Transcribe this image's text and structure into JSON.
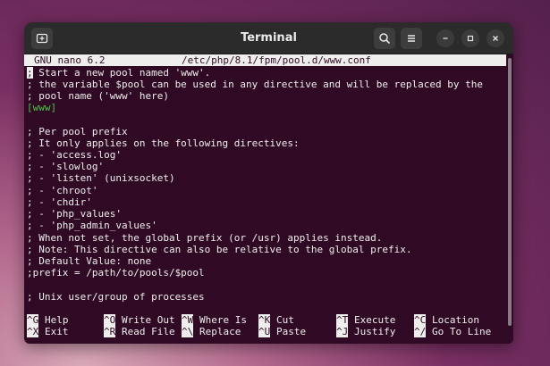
{
  "window": {
    "title": "Terminal",
    "new_tab_icon": "new-tab-icon",
    "search_icon": "search-icon",
    "menu_icon": "hamburger-menu-icon",
    "minimize_icon": "minimize-icon",
    "maximize_icon": "maximize-icon",
    "close_icon": "close-icon"
  },
  "nano": {
    "version": "GNU nano 6.2",
    "filename": "/etc/php/8.1/fpm/pool.d/www.conf",
    "lines": {
      "l01": "; Start a new pool named 'www'.",
      "l02": "; the variable $pool can be used in any directive and will be replaced by the",
      "l03": "; pool name ('www' here)",
      "l04": "[www]",
      "l05": "",
      "l06": "; Per pool prefix",
      "l07": "; It only applies on the following directives:",
      "l08": "; - 'access.log'",
      "l09": "; - 'slowlog'",
      "l10": "; - 'listen' (unixsocket)",
      "l11": "; - 'chroot'",
      "l12": "; - 'chdir'",
      "l13": "; - 'php_values'",
      "l14": "; - 'php_admin_values'",
      "l15": "; When not set, the global prefix (or /usr) applies instead.",
      "l16": "; Note: This directive can also be relative to the global prefix.",
      "l17": "; Default Value: none",
      "l18": ";prefix = /path/to/pools/$pool",
      "l19": "",
      "l20": "; Unix user/group of processes"
    },
    "shortcuts": {
      "help_key": "^G",
      "help_label": "Help",
      "exit_key": "^X",
      "exit_label": "Exit",
      "writeout_key": "^O",
      "writeout_label": "Write Out",
      "readfile_key": "^R",
      "readfile_label": "Read File",
      "whereis_key": "^W",
      "whereis_label": "Where Is",
      "replace_key": "^\\",
      "replace_label": "Replace",
      "cut_key": "^K",
      "cut_label": "Cut",
      "paste_key": "^U",
      "paste_label": "Paste",
      "execute_key": "^T",
      "execute_label": "Execute",
      "justify_key": "^J",
      "justify_label": "Justify",
      "location_key": "^C",
      "location_label": "Location",
      "gotoline_key": "^/",
      "gotoline_label": "Go To Line"
    }
  }
}
